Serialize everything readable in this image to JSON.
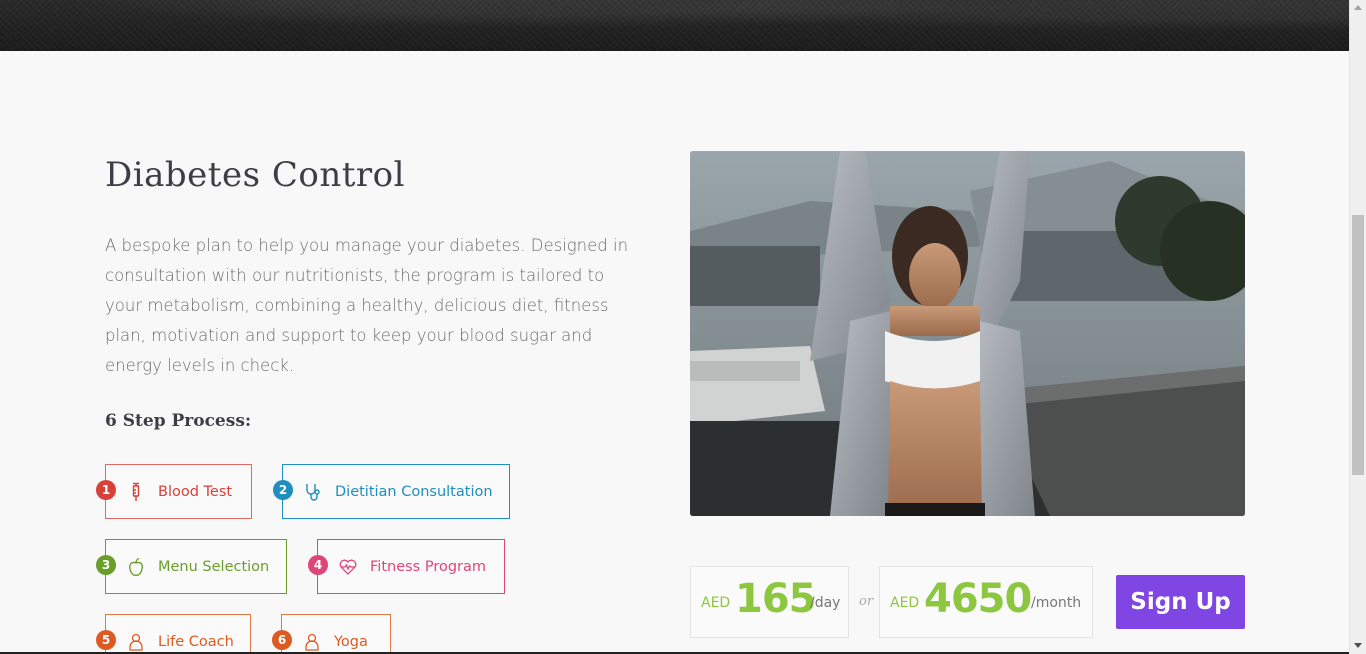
{
  "section": {
    "title": "Diabetes Control",
    "description": "A bespoke plan to help you manage your diabetes. Designed in consultation with our nutritionists, the program is tailored to your metabolism, combining a healthy, delicious diet, fitness plan, motivation and support to keep your blood sugar and energy levels in check.",
    "steps_heading": "6 Step Process:"
  },
  "steps": [
    {
      "number": "1",
      "label": "Blood Test",
      "icon": "syringe-icon",
      "color": "#d8403a"
    },
    {
      "number": "2",
      "label": "Dietitian Consultation",
      "icon": "stethoscope-icon",
      "color": "#1e8fbf"
    },
    {
      "number": "3",
      "label": "Menu Selection",
      "icon": "apple-icon",
      "color": "#6a9e2a"
    },
    {
      "number": "4",
      "label": "Fitness Program",
      "icon": "heartbeat-icon",
      "color": "#e0457a"
    },
    {
      "number": "5",
      "label": "Life Coach",
      "icon": "person-icon",
      "color": "#dd5a22"
    },
    {
      "number": "6",
      "label": "Yoga",
      "icon": "person-icon",
      "color": "#dd5a22"
    }
  ],
  "pricing": {
    "daily": {
      "currency": "AED",
      "amount": "165",
      "unit": "/day"
    },
    "separator": "or",
    "monthly": {
      "currency": "AED",
      "amount": "4650",
      "unit": "/month"
    },
    "cta_label": "Sign Up",
    "accent_color": "#8dc63f",
    "cta_color": "#8046e4"
  }
}
